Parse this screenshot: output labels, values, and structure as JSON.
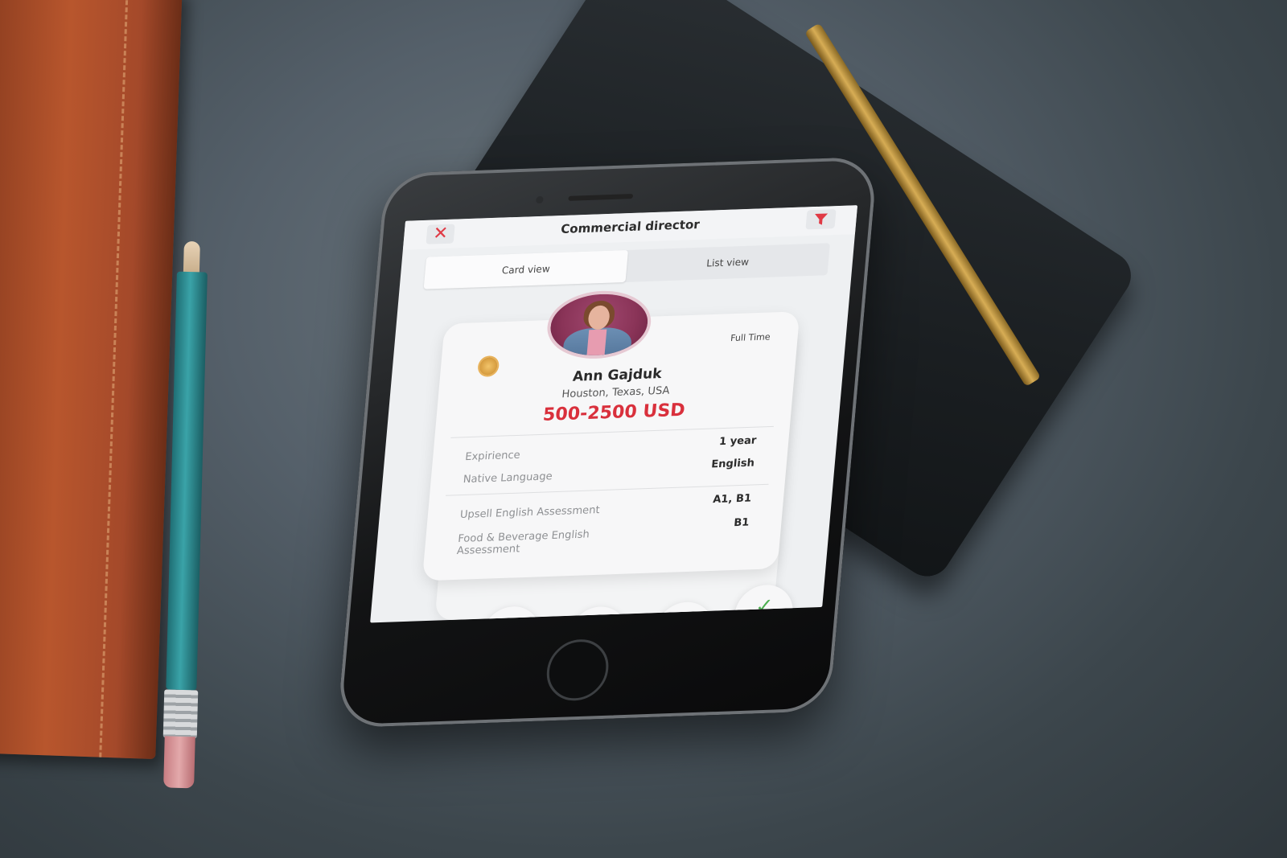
{
  "header": {
    "title": "Commercial director",
    "close_icon": "close-icon",
    "filter_icon": "filter-icon"
  },
  "tabs": [
    {
      "label": "Card view",
      "active": true
    },
    {
      "label": "List view",
      "active": false
    }
  ],
  "card": {
    "employment_type": "Full Time",
    "name": "Ann Gajduk",
    "location": "Houston, Texas, USA",
    "salary": "500-2500 USD",
    "details": [
      {
        "label": "Expirience",
        "value": "1 year"
      },
      {
        "label": "Native Language",
        "value": "English"
      }
    ],
    "assessments": [
      {
        "label": "Upsell English Assessment",
        "value": "A1, B1"
      },
      {
        "label": "Food & Beverage English Assessment",
        "value": "B1"
      }
    ]
  },
  "actions": {
    "reject_icon": "close-icon",
    "accept_icon": "check-icon"
  },
  "colors": {
    "accent": "#d9303c",
    "accept": "#4caf50"
  }
}
